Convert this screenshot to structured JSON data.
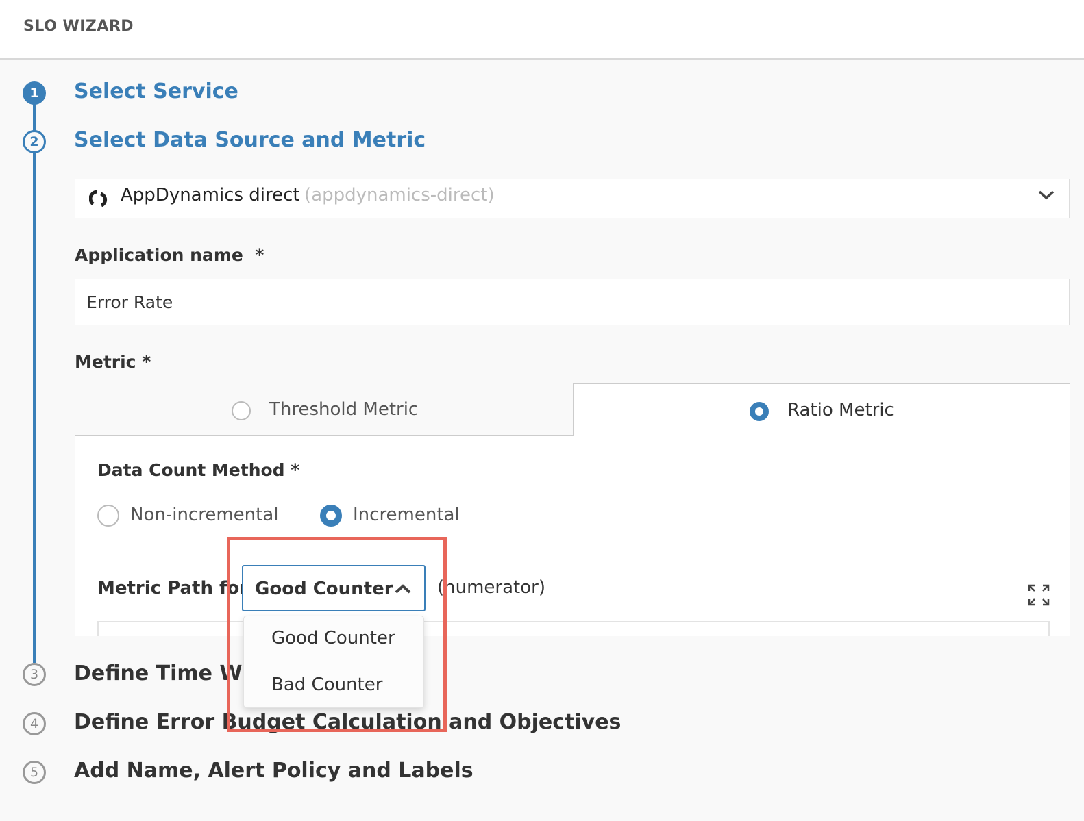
{
  "header": {
    "title": "SLO WIZARD"
  },
  "steps": [
    {
      "number": "1",
      "title": "Select Service",
      "state": "done"
    },
    {
      "number": "2",
      "title": "Select Data Source and Metric",
      "state": "current"
    },
    {
      "number": "3",
      "title": "Define Time Window",
      "state": "todo"
    },
    {
      "number": "4",
      "title": "Define Error Budget Calculation and Objectives",
      "state": "todo"
    },
    {
      "number": "5",
      "title": "Add Name, Alert Policy and Labels",
      "state": "todo"
    }
  ],
  "data_source": {
    "name": "AppDynamics direct",
    "id": "(appdynamics-direct)",
    "icon": "appdynamics-logo-icon"
  },
  "application_name": {
    "label": "Application name",
    "required": "*",
    "value": "Error Rate"
  },
  "metric": {
    "label": "Metric",
    "required": "*",
    "tabs": [
      {
        "label": "Threshold Metric",
        "selected": false
      },
      {
        "label": "Ratio Metric",
        "selected": true
      }
    ]
  },
  "data_count_method": {
    "label": "Data Count Method",
    "required": "*",
    "options": [
      {
        "label": "Non-incremental",
        "selected": false
      },
      {
        "label": "Incremental",
        "selected": true
      }
    ]
  },
  "metric_path": {
    "label_prefix": "Metric Path for",
    "selected": "Good Counter",
    "suffix": "(numerator)",
    "options": [
      "Good Counter",
      "Bad Counter"
    ]
  },
  "colors": {
    "accent": "#3a7fb8",
    "highlight": "#e8665a"
  }
}
